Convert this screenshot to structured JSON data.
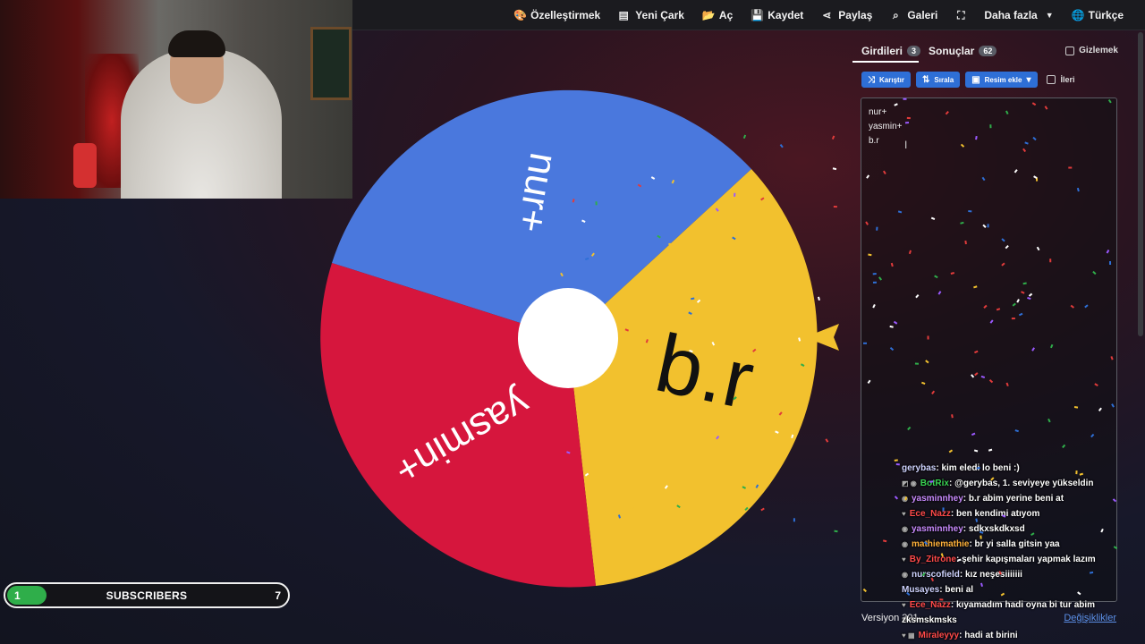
{
  "nav": {
    "items": [
      {
        "key": "customize",
        "icon": "palette-icon",
        "glyph": "🎨",
        "label": "Özelleştirmek"
      },
      {
        "key": "new",
        "icon": "file-icon",
        "glyph": "▤",
        "label": "Yeni Çark"
      },
      {
        "key": "open",
        "icon": "folder-icon",
        "glyph": "📂",
        "label": "Aç"
      },
      {
        "key": "save",
        "icon": "save-icon",
        "glyph": "💾",
        "label": "Kaydet"
      },
      {
        "key": "share",
        "icon": "share-icon",
        "glyph": "⋖",
        "label": "Paylaş"
      },
      {
        "key": "gallery",
        "icon": "search-icon",
        "glyph": "⌕",
        "label": "Galeri"
      },
      {
        "key": "fullscreen",
        "icon": "fullscreen-icon",
        "glyph": "⛶",
        "label": ""
      },
      {
        "key": "more",
        "icon": "chevron-down-icon",
        "glyph": "",
        "label": "Daha fazla"
      },
      {
        "key": "language",
        "icon": "globe-icon",
        "glyph": "🌐",
        "label": "Türkçe"
      }
    ]
  },
  "wheel": {
    "segments": [
      {
        "label": "nur+",
        "color": "#4a78dd"
      },
      {
        "label": "b.r",
        "color": "#f2c12e"
      },
      {
        "label": "yasmin+",
        "color": "#d6163d"
      }
    ],
    "pointer_color": "#f2c12e"
  },
  "panel": {
    "tabs": [
      {
        "label": "Girdileri",
        "count": "3"
      },
      {
        "label": "Sonuçlar",
        "count": "62"
      }
    ],
    "hide_label": "Gizlemek",
    "toolbar": {
      "shuffle": "Karıştır",
      "sort": "Sırala",
      "add_image": "Resim ekle",
      "advanced": "İleri"
    },
    "entries": [
      "nur+",
      "yasmin+",
      "b.r"
    ],
    "version": "Versiyon 391",
    "changes": "Değişiklikler"
  },
  "chat": [
    {
      "user": "gerybas",
      "color": "#cfd3ff",
      "text": " : kim eledi lo beni :)",
      "prefix": ""
    },
    {
      "user": "BotRix",
      "color": "#39d353",
      "text": " : @gerybas, 1. seviyeye yükseldin",
      "prefix": "◩ ◉"
    },
    {
      "user": "yasminnhey",
      "color": "#c98bff",
      "text": " : b.r abim yerine beni at",
      "prefix": "◉"
    },
    {
      "user": "Ece_Nazz",
      "color": "#ff4a4a",
      "text": " : ben kendimi atıyom",
      "prefix": "♥"
    },
    {
      "user": "yasminnhey",
      "color": "#c98bff",
      "text": " : sdkxskdkxsd",
      "prefix": "◉"
    },
    {
      "user": "mathiemathie",
      "color": "#ffb13b",
      "text": " : br yi salla gitsin yaa",
      "prefix": "◉"
    },
    {
      "user": "By_Zitrone",
      "color": "#ff4a4a",
      "text": " : şehir kapışmaları yapmak lazım",
      "prefix": "♥"
    },
    {
      "user": "nurscofield",
      "color": "#cfd3ff",
      "text": " : kız neşesiiiiiii",
      "prefix": "◉"
    },
    {
      "user": "Musayes",
      "color": "#cfd3ff",
      "text": " : beni al",
      "prefix": ""
    },
    {
      "user": "Ece_Nazz",
      "color": "#ff4a4a",
      "text": " : kıyamadım hadi oyna bi tur abim",
      "prefix": "♥"
    },
    {
      "user": "",
      "color": "#ffffff",
      "text": "zksmskmsks",
      "prefix": ""
    },
    {
      "user": "Miraleyyy",
      "color": "#ff4a4a",
      "text": " : hadi at birini",
      "prefix": "♥ ▦"
    }
  ],
  "subscribers": {
    "label": "SUBSCRIBERS",
    "current": "1",
    "goal": "7",
    "progress_fraction": 0.143,
    "bar_color": "#2fae4a"
  }
}
